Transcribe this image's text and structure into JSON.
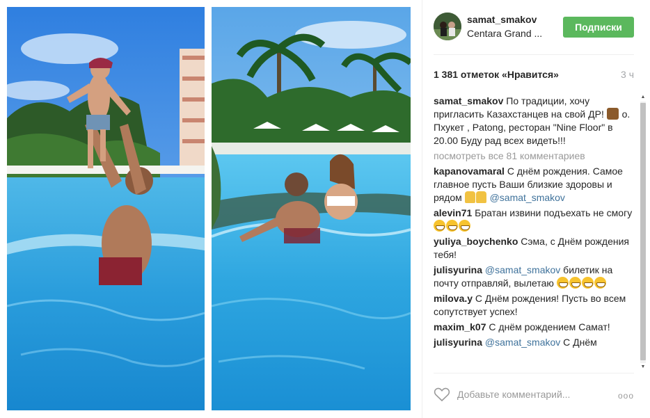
{
  "post": {
    "username": "samat_smakov",
    "location": "Centara Grand ...",
    "follow_label": "Подписки",
    "likes": "1 381 отметок «Нравится»",
    "time": "3 ч",
    "view_all": "посмотреть все 81 комментариев",
    "comment_placeholder": "Добавьте комментарий...",
    "more": "ooo"
  },
  "caption": {
    "user": "samat_smakov",
    "text_a": "По традиции, хочу пригласить Казахстанцев на свой ДР! ",
    "text_b": " о. Пхукет , Patong, ресторан \"Nine Floor\" в 20.00 Буду рад всех видеть!!!"
  },
  "comments": [
    {
      "user": "kapanovamaral",
      "text": "С днём рождения. Самое главное пусть Ваши близкие здоровы и рядом ",
      "mention": "",
      "mention_after": "@samat_smakov"
    },
    {
      "user": "alevin71",
      "text": "Братан извини подъехать не смогу",
      "mention": "",
      "mention_after": ""
    },
    {
      "user": "yuliya_boychenko",
      "text": "Сэма, с Днём рождения тебя!",
      "mention": "",
      "mention_after": ""
    },
    {
      "user": "julisyurina",
      "text": "билетик на почту отправляй, вылетаю ",
      "mention": "@samat_smakov",
      "mention_after": ""
    },
    {
      "user": "milova.y",
      "text": "С Днём рождения! Пусть во всем сопутствует успех!",
      "mention": "",
      "mention_after": ""
    },
    {
      "user": "maxim_k07",
      "text": "С днём рождением Самат!",
      "mention": "",
      "mention_after": ""
    },
    {
      "user": "julisyurina",
      "text": "С Днём",
      "mention": "@samat_smakov",
      "mention_after": ""
    }
  ],
  "icons": {
    "heart": "heart-icon",
    "more": "more-options-icon",
    "avatar": "avatar"
  },
  "colors": {
    "follow_button": "#5bb85d",
    "mention": "#3f729b",
    "muted": "#999999"
  }
}
